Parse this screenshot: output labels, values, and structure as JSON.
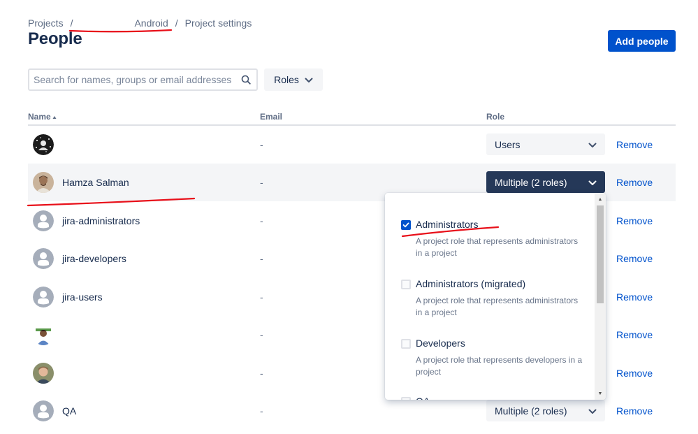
{
  "breadcrumb": {
    "projects": "Projects",
    "sep1": "/",
    "project": "Android",
    "sep2": "/",
    "settings": "Project settings"
  },
  "page_title": "People",
  "add_button": "Add people",
  "search": {
    "placeholder": "Search for names, groups or email addresses"
  },
  "roles_filter": "Roles",
  "table": {
    "headers": {
      "name": "Name",
      "email": "Email",
      "role": "Role"
    },
    "rows": [
      {
        "name": "",
        "email": "-",
        "role": "Users",
        "remove": "Remove",
        "avatar": "dark-pattern-avatar"
      },
      {
        "name": "Hamza Salman",
        "email": "-",
        "role": "Multiple (2 roles)",
        "remove": "Remove",
        "avatar": "photo-avatar"
      },
      {
        "name": "jira-administrators",
        "email": "-",
        "remove": "Remove",
        "avatar": "group-avatar"
      },
      {
        "name": "jira-developers",
        "email": "-",
        "remove": "Remove",
        "avatar": "group-avatar"
      },
      {
        "name": "jira-users",
        "email": "-",
        "remove": "Remove",
        "avatar": "group-avatar"
      },
      {
        "name": "",
        "email": "-",
        "remove": "Remove",
        "avatar": "photo-avatar"
      },
      {
        "name": "",
        "email": "-",
        "remove": "Remove",
        "avatar": "photo-avatar"
      },
      {
        "name": "QA",
        "email": "-",
        "role": "Multiple (2 roles)",
        "remove": "Remove",
        "avatar": "group-avatar"
      }
    ]
  },
  "role_dropdown": {
    "options": [
      {
        "label": "Administrators",
        "checked": true,
        "description": "A project role that represents administrators in a project"
      },
      {
        "label": "Administrators (migrated)",
        "checked": false,
        "description": "A project role that represents administrators in a project"
      },
      {
        "label": "Developers",
        "checked": false,
        "description": "A project role that represents developers in a project"
      },
      {
        "label": "QA",
        "checked": false
      }
    ]
  },
  "colors": {
    "primary": "#0052cc",
    "selected_role": "#253858",
    "annotation": "#e8101a"
  }
}
